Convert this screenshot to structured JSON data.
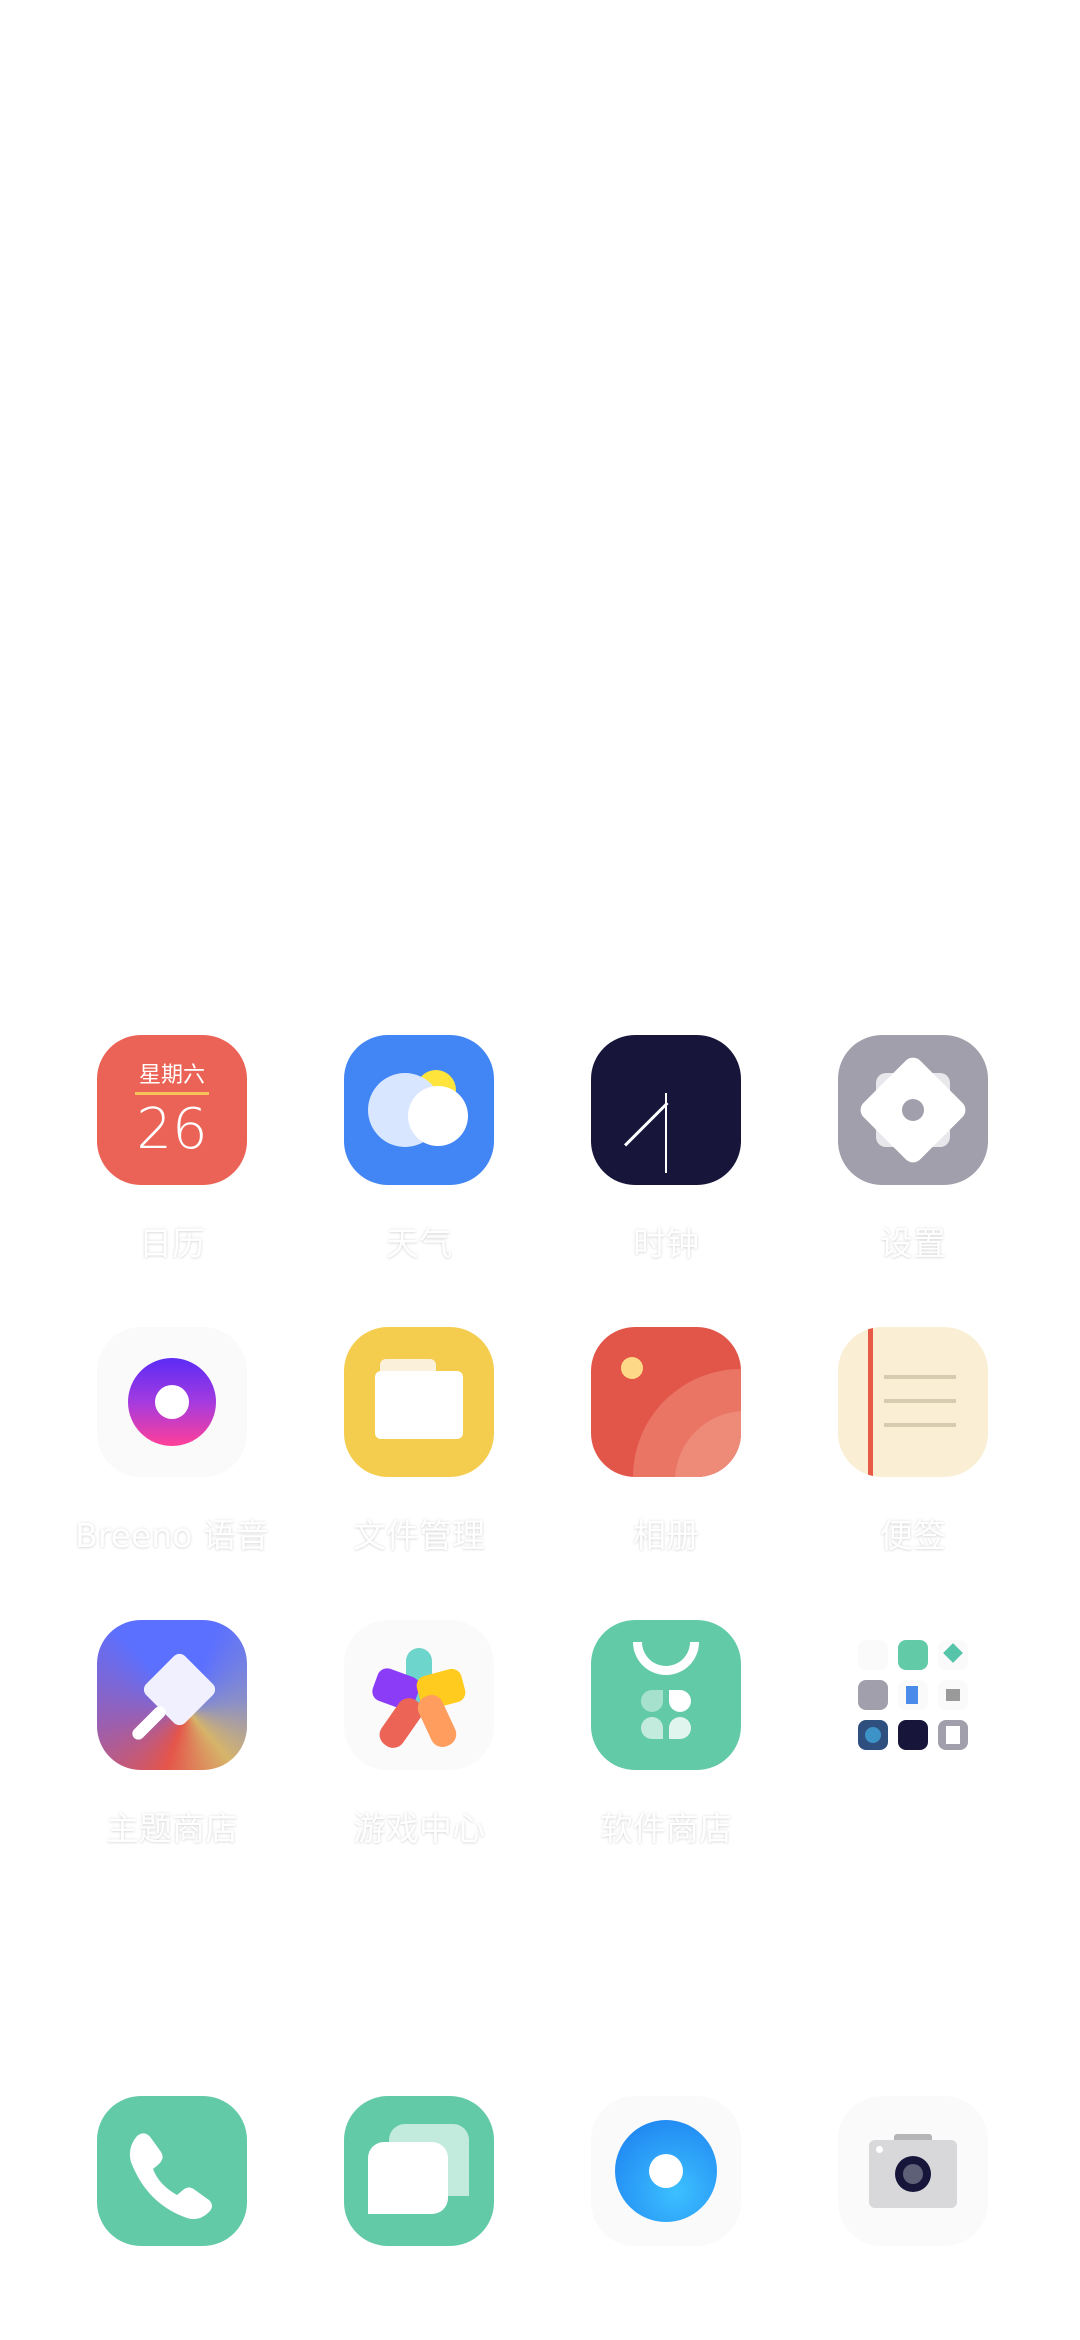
{
  "apps": [
    {
      "label": "日历",
      "weekday": "星期六",
      "day": "26"
    },
    {
      "label": "天气"
    },
    {
      "label": "时钟"
    },
    {
      "label": "设置"
    },
    {
      "label": "Breeno 语音"
    },
    {
      "label": "文件管理"
    },
    {
      "label": "相册"
    },
    {
      "label": "便签"
    },
    {
      "label": "主题商店"
    },
    {
      "label": "游戏中心"
    },
    {
      "label": "软件商店"
    }
  ],
  "dock": [
    "phone",
    "messages",
    "browser",
    "camera"
  ],
  "colors": {
    "calendar": "#EB6356",
    "weather": "#4285F4",
    "clock": "#17163A",
    "settings": "#A09FAB",
    "files": "#F4CD4F",
    "gallery": "#E2564A",
    "notes": "#FAEFD4",
    "market": "#63CAA7"
  }
}
